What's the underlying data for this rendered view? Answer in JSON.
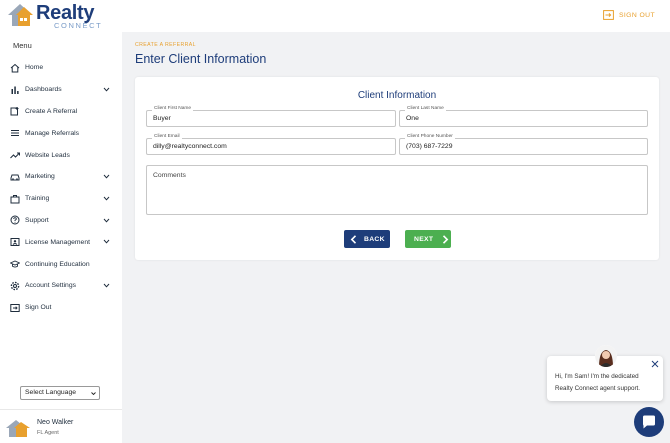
{
  "brand": {
    "name": "Realty",
    "sub": "CONNECT",
    "primary": "#1e3d7a",
    "accent": "#e8a02e",
    "success": "#4caf50"
  },
  "sidebar": {
    "heading": "Menu",
    "items": [
      {
        "label": "Home",
        "icon": "home-icon",
        "expandable": false
      },
      {
        "label": "Dashboards",
        "icon": "bar-chart-icon",
        "expandable": true
      },
      {
        "label": "Create A Referral",
        "icon": "create-referral-icon",
        "expandable": false
      },
      {
        "label": "Manage Referrals",
        "icon": "list-icon",
        "expandable": false
      },
      {
        "label": "Website Leads",
        "icon": "trending-icon",
        "expandable": false
      },
      {
        "label": "Marketing",
        "icon": "car-icon",
        "expandable": true
      },
      {
        "label": "Training",
        "icon": "briefcase-icon",
        "expandable": true
      },
      {
        "label": "Support",
        "icon": "help-icon",
        "expandable": true
      },
      {
        "label": "License Management",
        "icon": "id-card-icon",
        "expandable": true
      },
      {
        "label": "Continuing Education",
        "icon": "graduation-cap-icon",
        "expandable": false
      },
      {
        "label": "Account Settings",
        "icon": "gear-icon",
        "expandable": true
      },
      {
        "label": "Sign Out",
        "icon": "sign-out-icon",
        "expandable": false
      }
    ],
    "language_select": "Select Language",
    "user": {
      "name": "Neo Walker",
      "role": "FL Agent"
    }
  },
  "topbar": {
    "sign_out": "SIGN OUT"
  },
  "main": {
    "breadcrumb": "CREATE A REFERRAL",
    "title": "Enter Client Information",
    "card_title": "Client Information",
    "fields": {
      "first_name": {
        "label": "Client First Name",
        "value": "Buyer"
      },
      "last_name": {
        "label": "Client Last Name",
        "value": "One"
      },
      "email": {
        "label": "Client Email",
        "value": "dilly@realtyconnect.com"
      },
      "phone": {
        "label": "Client Phone Number",
        "value": "(703) 687-7229"
      },
      "comments": {
        "placeholder": "Comments"
      }
    },
    "back_label": "BACK",
    "next_label": "NEXT"
  },
  "chat": {
    "line1": "Hi, I'm Sam! I'm the dedicated",
    "line2": "Realty Connect agent support."
  }
}
